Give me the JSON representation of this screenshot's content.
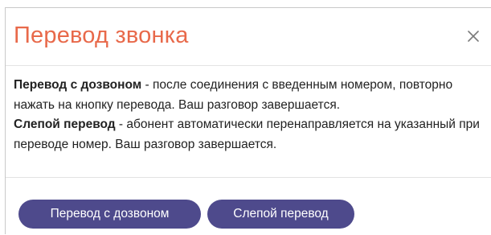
{
  "dialog": {
    "title": "Перевод звонка",
    "close_icon": "close-icon",
    "accent_color": "#e8694a",
    "button_color": "#4e4a8c"
  },
  "description": {
    "attended_term": "Перевод с дозвоном",
    "attended_text": " - после соединения с введенным номером, повторно нажать на кнопку перевода. Ваш разговор завершается.",
    "blind_term": "Слепой перевод",
    "blind_text": " - абонент автоматически перенаправляется на указанный при переводе номер. Ваш разговор завершается."
  },
  "buttons": {
    "attended_label": "Перевод с дозвоном",
    "blind_label": "Слепой перевод"
  }
}
